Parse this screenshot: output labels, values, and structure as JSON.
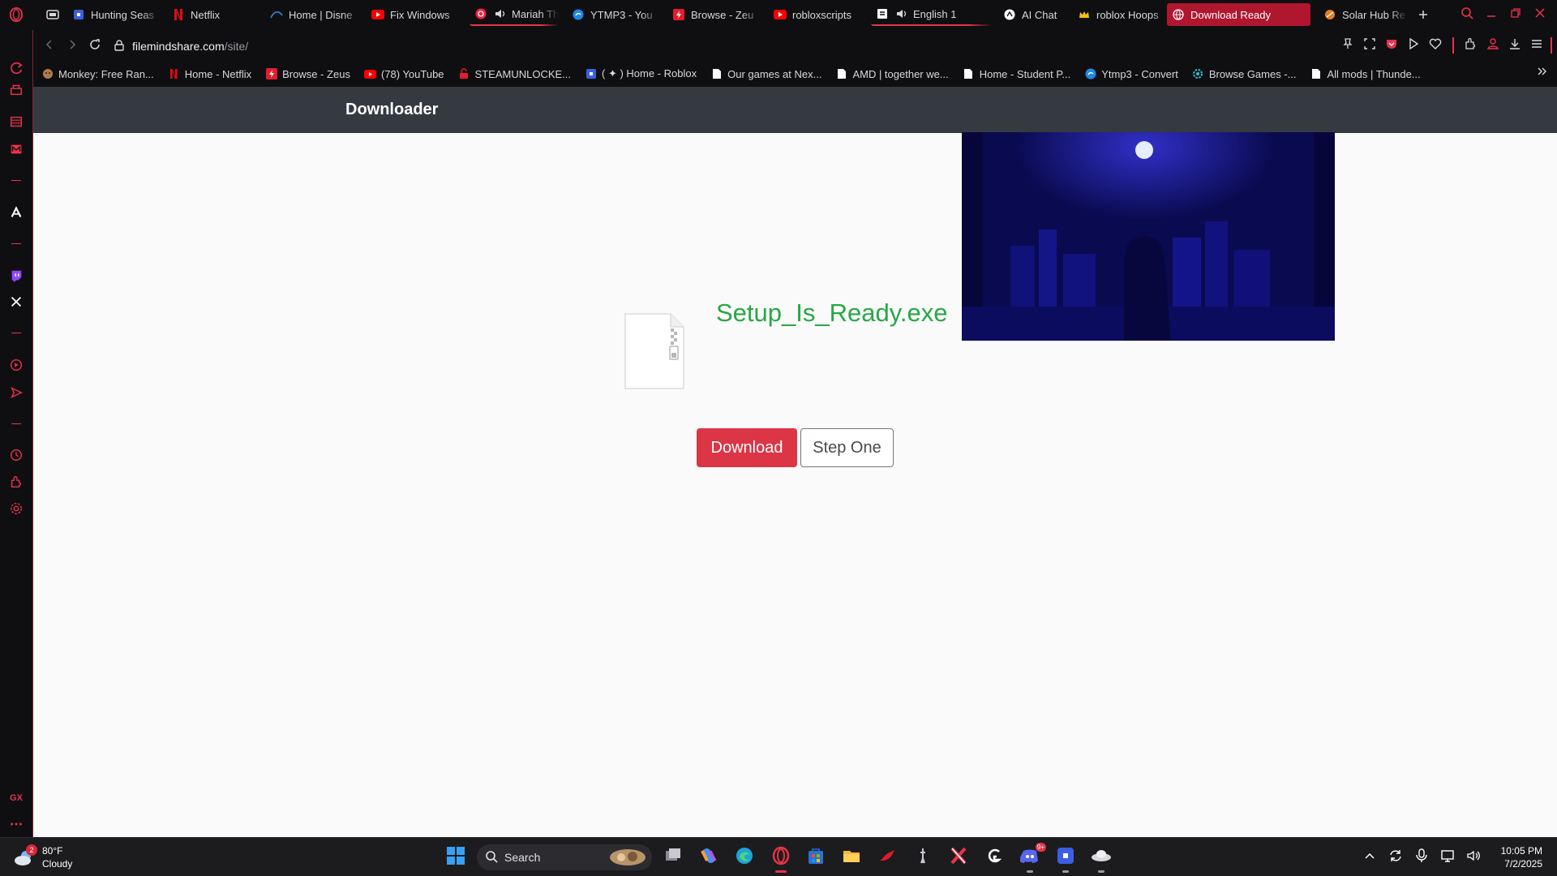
{
  "tabs": [
    {
      "label": "Hunting Seas",
      "icon": "roblox-icon"
    },
    {
      "label": "Netflix",
      "icon": "netflix-icon"
    },
    {
      "label": "Home | Disne",
      "icon": "disney-icon"
    },
    {
      "label": "Fix Windows",
      "icon": "youtube-icon"
    },
    {
      "label": "Mariah Th",
      "icon": "speaker-icon"
    },
    {
      "label": "YTMP3 - You",
      "icon": "ytmp3-icon"
    },
    {
      "label": "Browse - Zeu",
      "icon": "zeus-icon"
    },
    {
      "label": "robloxscripts",
      "icon": "youtube-icon"
    },
    {
      "label": "English 1",
      "icon": "speaker-icon"
    },
    {
      "label": "AI Chat",
      "icon": "chat-icon"
    },
    {
      "label": "roblox Hoops",
      "icon": "crown-icon"
    },
    {
      "label": "Download Ready",
      "icon": "globe-icon"
    },
    {
      "label": "Solar Hub Re",
      "icon": "solar-icon"
    }
  ],
  "address": {
    "domain": "filemindshare.com",
    "path": "/site/"
  },
  "bookmarks": [
    {
      "label": "Monkey: Free Ran...",
      "icon": "monkey-icon"
    },
    {
      "label": "Home - Netflix",
      "icon": "netflix-icon"
    },
    {
      "label": "Browse - Zeus",
      "icon": "zeus-icon"
    },
    {
      "label": "(78) YouTube",
      "icon": "youtube-icon"
    },
    {
      "label": "STEAMUNLOCKE...",
      "icon": "steamunlocked-icon"
    },
    {
      "label": "( ✦ ) Home - Roblox",
      "icon": "roblox-icon"
    },
    {
      "label": "Our games at Nex...",
      "icon": "page-icon"
    },
    {
      "label": "AMD | together we...",
      "icon": "page-icon"
    },
    {
      "label": "Home - Student P...",
      "icon": "page-icon"
    },
    {
      "label": "Ytmp3 - Convert",
      "icon": "ytmp3-icon"
    },
    {
      "label": "Browse Games -...",
      "icon": "gear-icon"
    },
    {
      "label": "All mods | Thunde...",
      "icon": "page-icon"
    }
  ],
  "site": {
    "title": "Downloader",
    "filename": "Setup_Is_Ready.exe",
    "download_label": "Download",
    "step_label": "Step One"
  },
  "taskbar": {
    "temperature": "80°F",
    "condition": "Cloudy",
    "weather_badge": "2",
    "search_label": "Search",
    "discord_badge": "9+",
    "time": "10:05 PM",
    "date": "7/2/2025"
  },
  "sidebar": {
    "gx_label": "GX"
  },
  "colors": {
    "accent": "#e8334a",
    "active_tab": "#b0162e",
    "header": "#343a40",
    "filename": "#28a745",
    "download_button": "#dc3545"
  }
}
